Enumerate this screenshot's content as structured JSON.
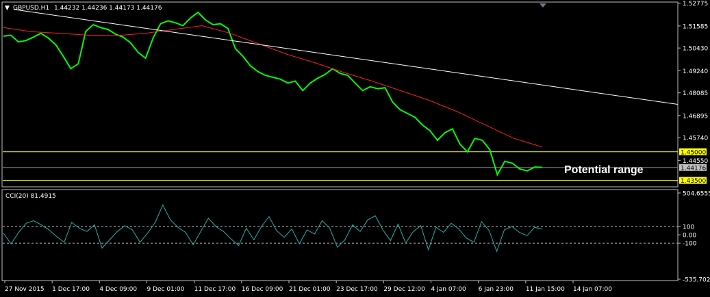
{
  "header": {
    "symbol_title": "GBPUSD,H1",
    "ohlc": "1.44232 1.44236 1.44173 1.44176",
    "cci_title": "CCI(20) 81.4915"
  },
  "colors": {
    "background": "#000000",
    "frame": "#c0c0c0",
    "price_line": "#00ff00",
    "moving_average": "#ff2020",
    "trendline": "#ffffff",
    "range_line": "#ffff00",
    "cci_line": "#20b2aa"
  },
  "chart_data": [
    {
      "type": "line",
      "panel": "main",
      "y_ticks": [
        "1.52775",
        "1.51585",
        "1.50430",
        "1.49240",
        "1.48085",
        "1.46895",
        "1.45740",
        "1.44550",
        "1.44176"
      ],
      "ylim": [
        1.432,
        1.528
      ],
      "x_ticks": [
        "27 Nov 2015",
        "1 Dec 17:00",
        "4 Dec 09:00",
        "9 Dec 01:00",
        "11 Dec 17:00",
        "16 Dec 09:00",
        "21 Dec 01:00",
        "23 Dec 17:00",
        "29 Dec 12:00",
        "4 Jan 07:00",
        "6 Jan 23:00",
        "11 Jan 15:00",
        "14 Jan 07:00"
      ],
      "x_count": 13,
      "series": [
        {
          "role": "price",
          "values": [
            1.5105,
            1.511,
            1.5075,
            1.5082,
            1.51,
            1.512,
            1.5095,
            1.506,
            1.5,
            1.4935,
            1.496,
            1.513,
            1.5165,
            1.515,
            1.514,
            1.5115,
            1.51,
            1.507,
            1.502,
            1.499,
            1.5095,
            1.517,
            1.5185,
            1.5175,
            1.516,
            1.52,
            1.523,
            1.519,
            1.5165,
            1.517,
            1.5145,
            1.504,
            1.5,
            1.495,
            1.492,
            1.49,
            1.489,
            1.488,
            1.486,
            1.487,
            1.482,
            1.486,
            1.4885,
            1.4905,
            1.4935,
            1.491,
            1.49,
            1.486,
            1.482,
            1.484,
            1.483,
            1.4835,
            1.476,
            1.472,
            1.47,
            1.468,
            1.464,
            1.461,
            1.456,
            1.46,
            1.462,
            1.454,
            1.45,
            1.457,
            1.456,
            1.451,
            1.438,
            1.445,
            1.444,
            1.441,
            1.44,
            1.442,
            1.4418
          ],
          "source_note": null
        },
        {
          "role": "moving_average",
          "values": [
            1.515,
            1.5128,
            1.512,
            1.511,
            1.5108,
            1.512,
            1.514,
            1.516,
            1.512,
            1.5065,
            1.501,
            1.4965,
            1.4915,
            1.487,
            1.482,
            1.477,
            1.471,
            1.464,
            1.457,
            1.4525
          ],
          "source_note": null
        },
        {
          "role": "trendline",
          "values": [
            1.5245,
            1.4748
          ]
        }
      ],
      "horizontal_levels": [
        {
          "value": 1.45,
          "label": "1.45000"
        },
        {
          "value": 1.435,
          "label": "1.43500"
        },
        {
          "value": 1.44176,
          "label": "1.44176"
        }
      ],
      "annotation": "Potential range"
    },
    {
      "type": "line",
      "panel": "cci",
      "title": "CCI(20) 81.4915",
      "y_ticks": [
        "504.6555",
        "100",
        "0.00",
        "-100",
        "-535.7025"
      ],
      "ylim": [
        -535.7025,
        504.6555
      ],
      "levels": [
        100,
        0,
        -100
      ],
      "series": [
        {
          "role": "cci",
          "values": [
            20,
            -110,
            30,
            140,
            170,
            120,
            60,
            -20,
            -90,
            150,
            80,
            40,
            120,
            -160,
            -60,
            40,
            110,
            60,
            -90,
            20,
            150,
            360,
            180,
            90,
            30,
            -120,
            40,
            200,
            100,
            40,
            -50,
            -130,
            80,
            -60,
            100,
            220,
            50,
            -30,
            70,
            -110,
            60,
            10,
            170,
            80,
            -150,
            -60,
            120,
            40,
            180,
            230,
            60,
            -70,
            130,
            -100,
            40,
            110,
            -180,
            90,
            30,
            140,
            70,
            -40,
            -90,
            160,
            50,
            -200,
            60,
            100,
            30,
            -10,
            90,
            70
          ]
        }
      ]
    }
  ]
}
